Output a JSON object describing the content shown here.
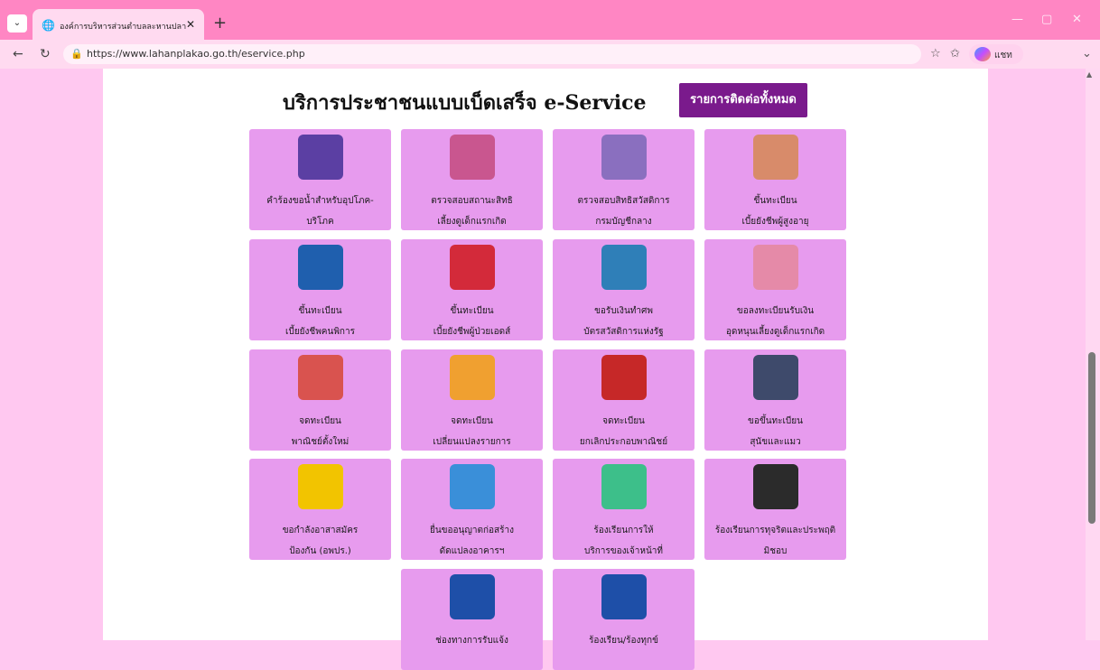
{
  "browser": {
    "tab_title": "องค์การบริหารส่วนตำบลละหานปลาค้าว",
    "url": "https://www.lahanplakao.go.th/eservice.php",
    "copilot_label": "แชท"
  },
  "page": {
    "heading": "บริการประชาชนแบบเบ็ดเสร็จ e-Service",
    "contact_button": "รายการติดต่อทั้งหมด"
  },
  "services": [
    {
      "l1": "คำร้องขอน้ำสำหรับอุปโภค-",
      "l2": "บริโภค",
      "icon": "google-form-icon",
      "color": "#5b3fa3"
    },
    {
      "l1": "ตรวจสอบสถานะสิทธิ",
      "l2": "เลี้ยงดูเด็กแรกเกิด",
      "icon": "mother-baby-icon",
      "color": "#c9568f"
    },
    {
      "l1": "ตรวจสอบสิทธิสวัสดิการ",
      "l2": "กรมบัญชีกลาง",
      "icon": "comptroller-seal-icon",
      "color": "#8a6fbf"
    },
    {
      "l1": "ขึ้นทะเบียน",
      "l2": "เบี้ยยังชีพผู้สูงอายุ",
      "icon": "elderly-couple-icon",
      "color": "#d88b6a"
    },
    {
      "l1": "ขึ้นทะเบียน",
      "l2": "เบี้ยยังชีพคนพิการ",
      "icon": "wheelchair-icon",
      "color": "#1f5fae"
    },
    {
      "l1": "ขึ้นทะเบียน",
      "l2": "เบี้ยยังชีพผู้ป่วยเอดส์",
      "icon": "aids-ribbon-icon",
      "color": "#d32a3a"
    },
    {
      "l1": "ขอรับเงินทำศพ",
      "l2": "บัตรสวัสดิการแห่งรัฐ",
      "icon": "id-card-icon",
      "color": "#2f7fb8"
    },
    {
      "l1": "ขอลงทะเบียนรับเงิน",
      "l2": "อุดหนุนเลี้ยงดูเด็กแรกเกิด",
      "icon": "newborn-baby-icon",
      "color": "#e58aa8"
    },
    {
      "l1": "จดทะเบียน",
      "l2": "พาณิชย์ตั้งใหม่",
      "icon": "shop-storefront-icon",
      "color": "#d9534f"
    },
    {
      "l1": "จดทะเบียน",
      "l2": "เปลี่ยนแปลงรายการ",
      "icon": "change-people-icon",
      "color": "#f0a030"
    },
    {
      "l1": "จดทะเบียน",
      "l2": "ยกเลิกประกอบพาณิชย์",
      "icon": "shop-cancelled-icon",
      "color": "#c62828"
    },
    {
      "l1": "ขอขึ้นทะเบียน",
      "l2": "สุนัขและแมว",
      "icon": "cat-dog-icon",
      "color": "#3e4a6b"
    },
    {
      "l1": "ขอกำลังอาสาสมัคร",
      "l2": "ป้องกัน (อพปร.)",
      "icon": "volunteer-badge-icon",
      "color": "#f2c400"
    },
    {
      "l1": "ยื่นขออนุญาตก่อสร้าง",
      "l2": "ดัดแปลงอาคารฯ",
      "icon": "buildings-icon",
      "color": "#3a8fd9"
    },
    {
      "l1": "ร้องเรียนการให้",
      "l2": "บริการของเจ้าหน้าที่",
      "icon": "chat-complaint-icon",
      "color": "#3dbf8a"
    },
    {
      "l1": "ร้องเรียนการทุจริตและประพฤติ",
      "l2": "มิชอบ",
      "icon": "no-corruption-icon",
      "color": "#2b2b2b"
    },
    {
      "l1": "ช่องทางการรับแจ้ง",
      "l2": "",
      "icon": "comment-bubble-icon",
      "color": "#1e4fa8"
    },
    {
      "l1": "ร้องเรียน/ร้องทุกข์",
      "l2": "",
      "icon": "comment-bubble-icon",
      "color": "#1e4fa8"
    }
  ]
}
